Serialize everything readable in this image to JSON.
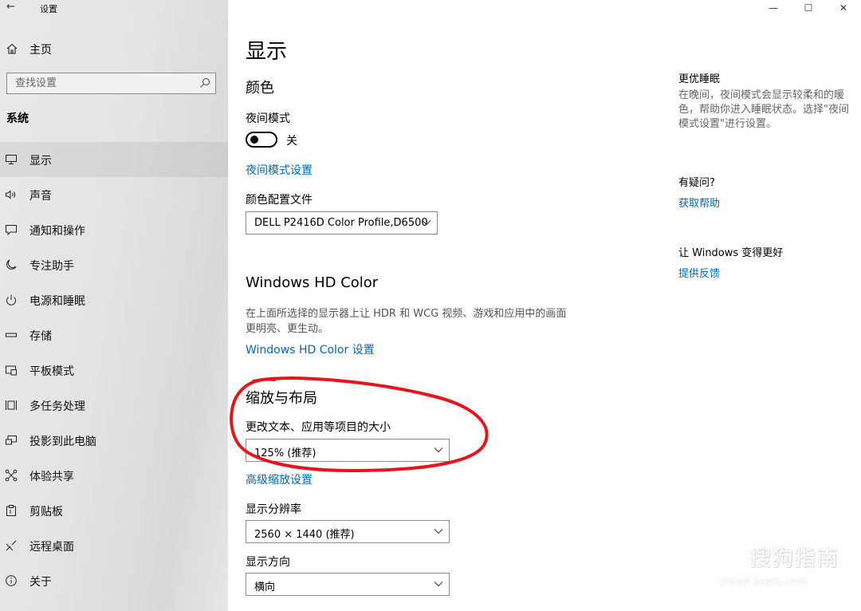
{
  "window": {
    "title": "设置",
    "controls": {
      "minimize": "—",
      "maximize": "☐",
      "close": "✕"
    }
  },
  "sidebar": {
    "home_label": "主页",
    "search_placeholder": "查找设置",
    "section_title": "系统",
    "items": [
      {
        "label": "显示",
        "icon": "monitor-icon",
        "active": true
      },
      {
        "label": "声音",
        "icon": "speaker-icon"
      },
      {
        "label": "通知和操作",
        "icon": "notification-icon"
      },
      {
        "label": "专注助手",
        "icon": "moon-icon"
      },
      {
        "label": "电源和睡眠",
        "icon": "power-icon"
      },
      {
        "label": "存储",
        "icon": "storage-icon"
      },
      {
        "label": "平板模式",
        "icon": "tablet-icon"
      },
      {
        "label": "多任务处理",
        "icon": "multitask-icon"
      },
      {
        "label": "投影到此电脑",
        "icon": "project-icon"
      },
      {
        "label": "体验共享",
        "icon": "share-icon"
      },
      {
        "label": "剪贴板",
        "icon": "clipboard-icon"
      },
      {
        "label": "远程桌面",
        "icon": "remote-desktop-icon"
      },
      {
        "label": "关于",
        "icon": "info-icon"
      }
    ]
  },
  "main": {
    "title": "显示",
    "color_section": {
      "heading": "颜色",
      "night_light_label": "夜间模式",
      "night_light_state": "关",
      "night_light_settings_link": "夜间模式设置",
      "color_profile_label": "颜色配置文件",
      "color_profile_value": "DELL P2416D Color Profile,D6500"
    },
    "hd_color_section": {
      "heading": "Windows HD Color",
      "description": "在上面所选择的显示器上让 HDR 和 WCG 视频、游戏和应用中的画面更明亮、更生动。",
      "settings_link": "Windows HD Color 设置"
    },
    "scale_section": {
      "heading": "缩放与布局",
      "scale_label": "更改文本、应用等项目的大小",
      "scale_value": "125% (推荐)",
      "advanced_link": "高级缩放设置",
      "resolution_label": "显示分辨率",
      "resolution_value": "2560 × 1440 (推荐)",
      "orientation_label": "显示方向",
      "orientation_value": "横向"
    }
  },
  "aside": {
    "sleep_heading": "更优睡眠",
    "sleep_text": "在晚间，夜间模式会显示较柔和的暖色，帮助你进入睡眠状态。选择\"夜间模式设置\"进行设置。",
    "question_heading": "有疑问?",
    "help_link": "获取帮助",
    "feedback_heading": "让 Windows 变得更好",
    "feedback_link": "提供反馈"
  },
  "watermark": {
    "main": "搜狗指南",
    "sub": "zhinan.sogou.com"
  },
  "colors": {
    "accent": "#0067c0",
    "annotation": "#e8141c",
    "sidebar_bg": "#e6e6e6"
  }
}
